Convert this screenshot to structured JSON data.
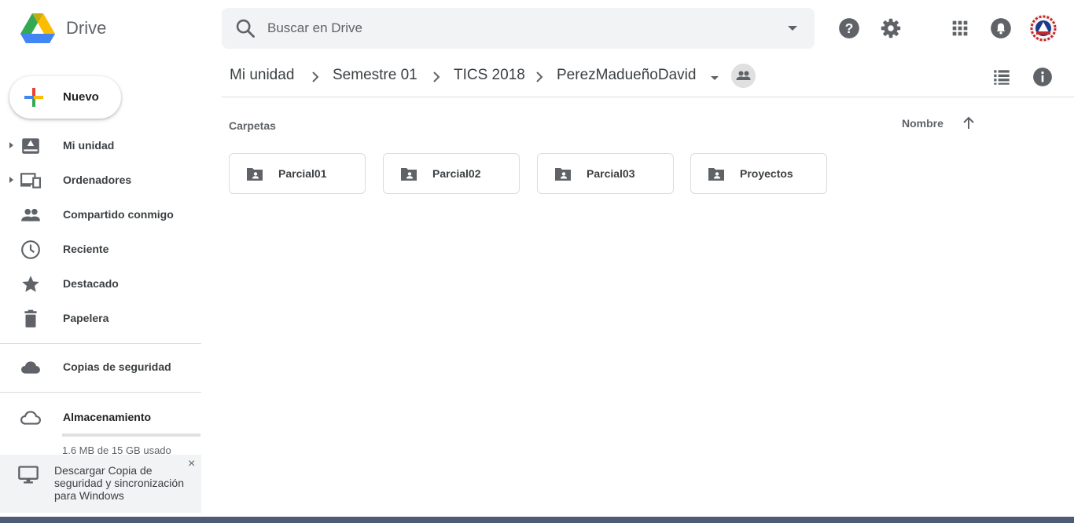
{
  "app": {
    "name": "Drive"
  },
  "search": {
    "placeholder": "Buscar en Drive"
  },
  "breadcrumb": [
    "Mi unidad",
    "Semestre 01",
    "TICS 2018",
    "PerezMadueñoDavid"
  ],
  "sidebar": {
    "new_label": "Nuevo",
    "items": [
      {
        "label": "Mi unidad",
        "icon": "my-drive-icon",
        "expandable": true
      },
      {
        "label": "Ordenadores",
        "icon": "computers-icon",
        "expandable": true
      },
      {
        "label": "Compartido conmigo",
        "icon": "shared-people-icon",
        "expandable": false
      },
      {
        "label": "Reciente",
        "icon": "clock-icon",
        "expandable": false
      },
      {
        "label": "Destacado",
        "icon": "star-icon",
        "expandable": false
      },
      {
        "label": "Papelera",
        "icon": "trash-icon",
        "expandable": false
      }
    ],
    "backups_label": "Copias de seguridad",
    "storage": {
      "label": "Almacenamiento",
      "used_text": "1.6 MB de 15 GB usado",
      "used_fraction": 0.0001
    },
    "promo": {
      "text": "Descargar Copia de seguridad y sincronización para Windows",
      "close": "×"
    }
  },
  "content": {
    "section_label": "Carpetas",
    "sort_label": "Nombre",
    "folders": [
      "Parcial01",
      "Parcial02",
      "Parcial03",
      "Proyectos"
    ]
  },
  "colors": {
    "accent": "#1a73e8",
    "icon_gray": "#5f6368",
    "taskbar": "#4d5b74"
  }
}
